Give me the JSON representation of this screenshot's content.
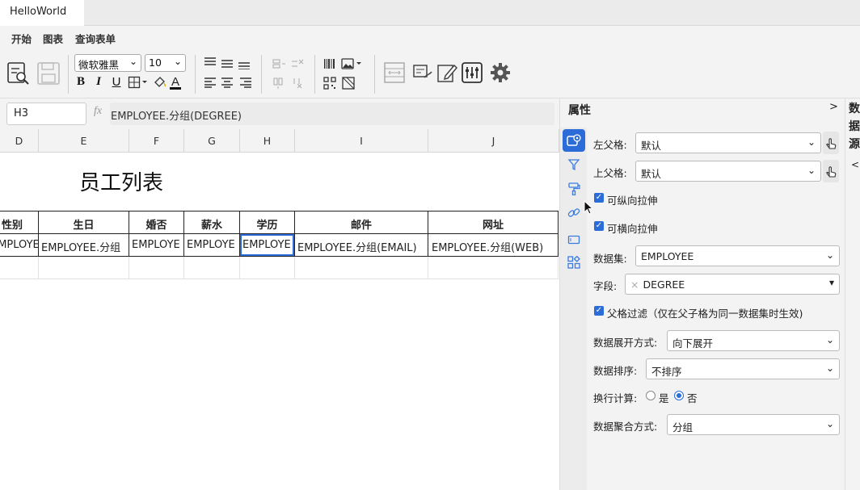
{
  "window": {
    "doc_tab": "HelloWorld"
  },
  "menu": {
    "items": [
      "开始",
      "图表",
      "查询表单"
    ],
    "active_index": 0
  },
  "toolbar": {
    "font_family": "微软雅黑",
    "font_size": "10",
    "icons": [
      "preview-icon",
      "save-icon",
      "bold-icon",
      "italic-icon",
      "underline-icon",
      "border-icon",
      "fill-color-icon",
      "font-color-icon",
      "align-top-icon",
      "align-middle-icon",
      "align-bottom-icon",
      "align-left-icon",
      "align-center-icon",
      "align-right-icon",
      "insert-row-icon",
      "delete-row-icon",
      "insert-col-icon",
      "delete-col-icon",
      "barcode-icon",
      "image-icon",
      "qrcode-icon",
      "slash-icon",
      "merge-icon",
      "sign-icon",
      "edit-icon",
      "sliders-icon",
      "gear-icon"
    ],
    "fmt": {
      "bold": "B",
      "italic": "I",
      "underline": "U",
      "font_color": "A"
    }
  },
  "formula_bar": {
    "cell_ref": "H3",
    "fx": "fx",
    "formula": "EMPLOYEE.分组(DEGREE)"
  },
  "sheet": {
    "columns": [
      "D",
      "E",
      "F",
      "G",
      "H",
      "I",
      "J"
    ],
    "title": "员工列表",
    "headers": [
      "性别",
      "生日",
      "婚否",
      "薪水",
      "学历",
      "邮件",
      "网址"
    ],
    "data_row": [
      "EMPLOYEE",
      "EMPLOYEE.分组",
      "EMPLOYE",
      "EMPLOYE",
      "EMPLOYE",
      "EMPLOYEE.分组(EMAIL)",
      "EMPLOYEE.分组(WEB)"
    ],
    "selected_cell": "H3"
  },
  "properties": {
    "title": "属性",
    "collapse": ">",
    "left_parent": {
      "label": "左父格:",
      "value": "默认"
    },
    "top_parent": {
      "label": "上父格:",
      "value": "默认"
    },
    "vertical_stretch": {
      "label": "可纵向拉伸",
      "checked": true
    },
    "horizontal_stretch": {
      "label": "可横向拉伸",
      "checked": true
    },
    "dataset": {
      "label": "数据集:",
      "value": "EMPLOYEE"
    },
    "field": {
      "label": "字段:",
      "value": "DEGREE",
      "remove": "×"
    },
    "parent_filter": {
      "label": "父格过滤（仅在父子格为同一数据集时生效)",
      "checked": true
    },
    "expand_mode": {
      "label": "数据展开方式:",
      "value": "向下展开"
    },
    "sort": {
      "label": "数据排序:",
      "value": "不排序"
    },
    "line_calc": {
      "label": "换行计算:",
      "yes": "是",
      "no": "否",
      "selected": "否"
    },
    "aggregate": {
      "label": "数据聚合方式:",
      "value": "分组"
    },
    "tabs": [
      "property-icon",
      "filter-icon",
      "format-brush-icon",
      "link-icon",
      "widget-icon",
      "expand-icon"
    ]
  },
  "datasource": {
    "title": "数据源",
    "arrow": "<"
  },
  "colors": {
    "accent": "#2b6cd8",
    "panel": "#f3f3f3"
  }
}
